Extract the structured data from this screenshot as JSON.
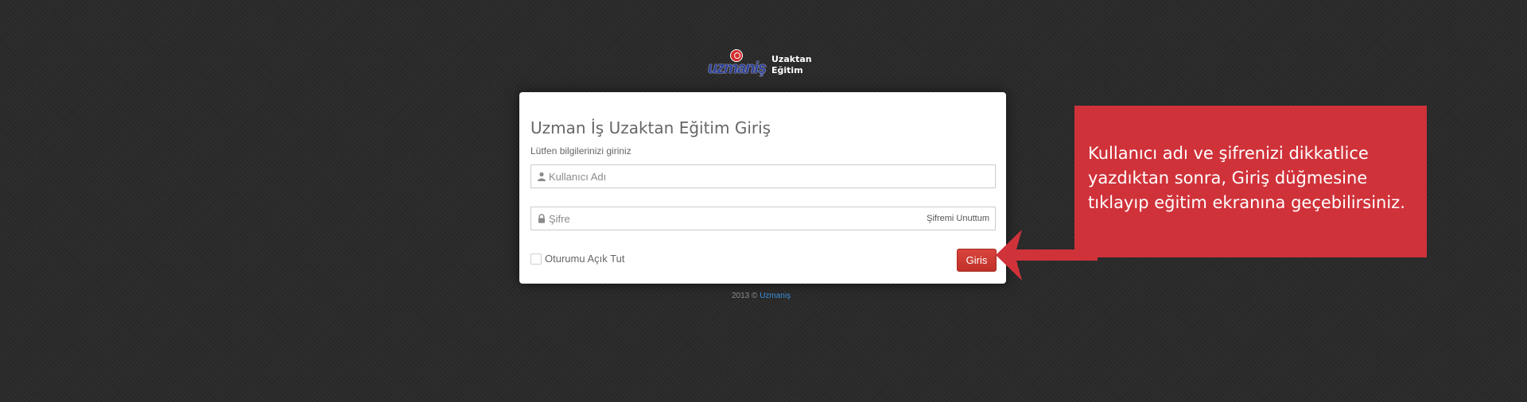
{
  "logo": {
    "wordmark": "uzmaniş",
    "line1": "Uzaktan",
    "line2": "Eğitim"
  },
  "login": {
    "title": "Uzman İş Uzaktan Eğitim Giriş",
    "subtitle": "Lütfen bilgilerinizi giriniz",
    "username": {
      "value": "",
      "placeholder": "Kullanıcı Adı"
    },
    "password": {
      "value": "",
      "placeholder": "Şifre"
    },
    "forgot_label": "Şifremi Unuttum",
    "remember_label": "Oturumu Açık Tut",
    "remember_checked": false,
    "submit_label": "Giris"
  },
  "footer": {
    "year": "2013 ©",
    "link": "Uzmaniş"
  },
  "callout": {
    "text": "Kullanıcı adı ve şifrenizi dikkatlice yazdıktan sonra, Giriş düğmesine tıklayıp eğitim ekranına geçebilirsiniz."
  },
  "colors": {
    "background": "#2b2b2b",
    "accent_red": "#d0323a",
    "button_red": "#c8372f",
    "link_blue": "#3a8fd8",
    "logo_blue": "#2c3f9b"
  },
  "icons": {
    "user_field": "user-icon",
    "password_field": "lock-icon",
    "callout_pointer": "arrow-left-icon"
  }
}
